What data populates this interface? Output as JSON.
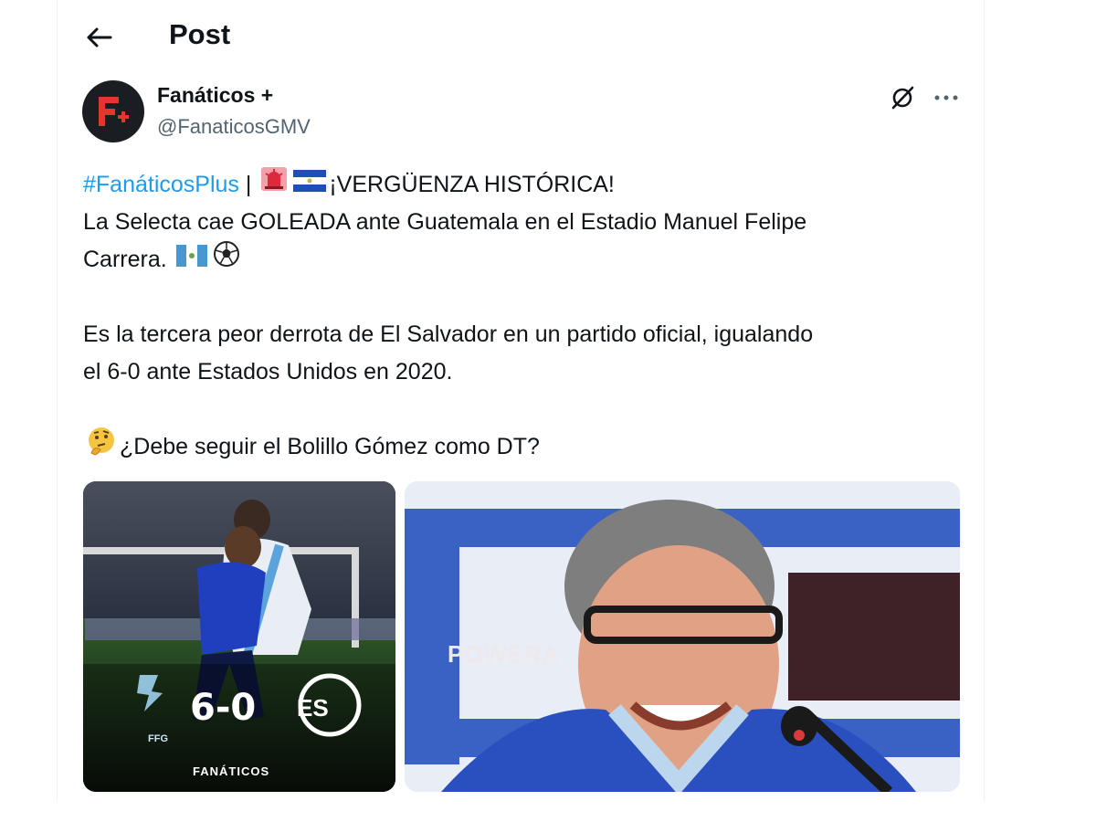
{
  "header": {
    "title": "Post",
    "back_icon": "arrow-left-icon"
  },
  "author": {
    "name": "Fanáticos +",
    "handle": "@FanaticosGMV",
    "avatar_icon": "fanaticos-logo-icon"
  },
  "actions": {
    "grok_icon": "grok-icon",
    "more_icon": "more-horizontal-icon"
  },
  "tweet": {
    "hashtag": "#FanáticosPlus",
    "separator": "|",
    "headline": "¡VERGÜENZA HISTÓRICA!",
    "line2": "La Selecta cae GOLEADA ante Guatemala en el Estadio Manuel Felipe",
    "line3": "Carrera.",
    "line4": "Es la tercera peor derrota de El Salvador en un partido oficial, igualando",
    "line5": "el 6-0 ante Estados Unidos en 2020.",
    "line6": "¿Debe seguir el Bolillo Gómez como DT?",
    "emojis": [
      "police-light-emoji",
      "el-salvador-flag-emoji",
      "guatemala-flag-emoji",
      "soccer-ball-emoji",
      "thinking-face-emoji"
    ]
  },
  "media": {
    "left": {
      "score": "6-0",
      "ffg_label": "FFG",
      "es_badge": "ES",
      "brand": "FANÁTICOS"
    },
    "right": {
      "background_text": "POWERA"
    }
  },
  "colors": {
    "link": "#1d9bf0",
    "text": "#0f1419",
    "secondary": "#536471",
    "brand_accent": "#e4352f"
  }
}
